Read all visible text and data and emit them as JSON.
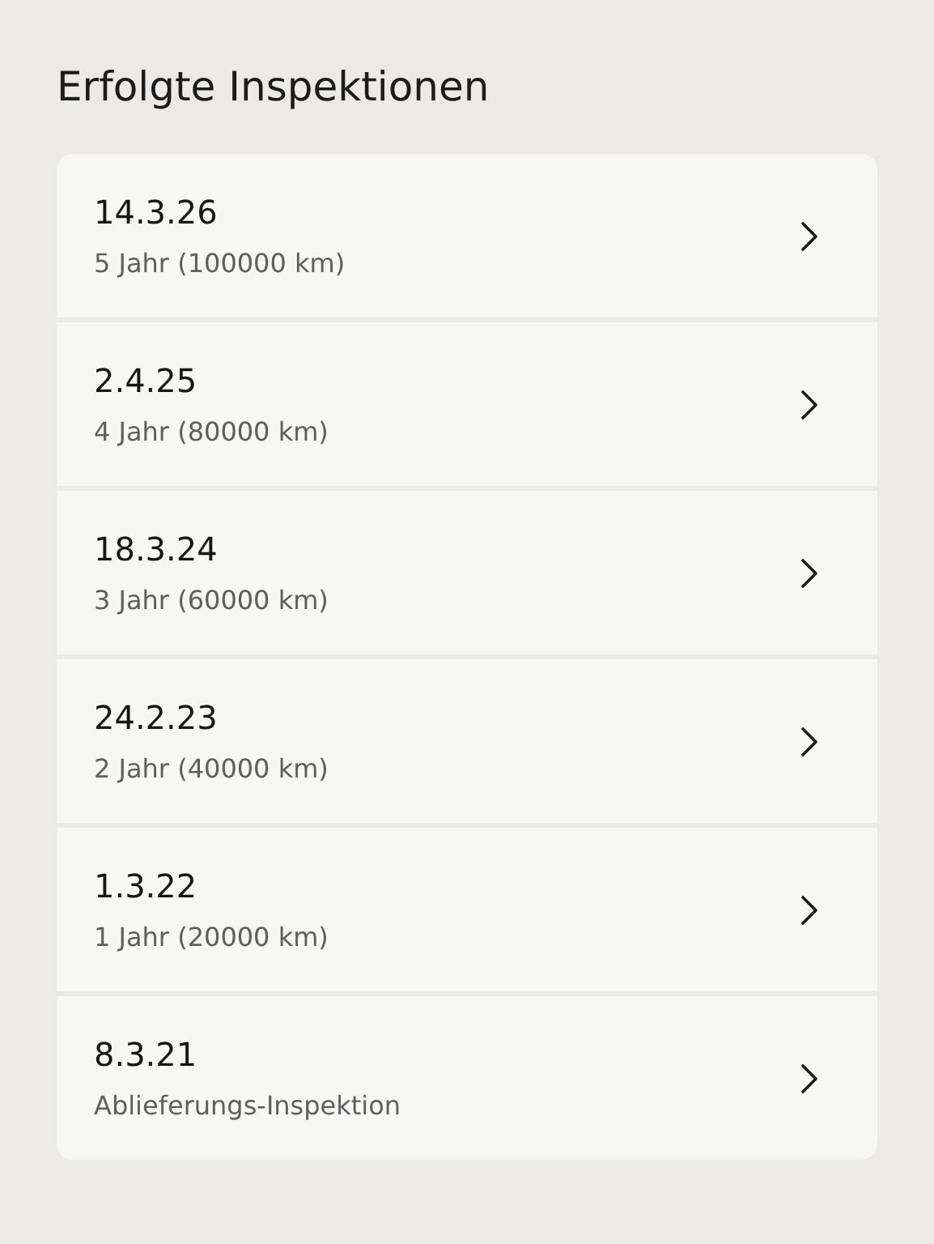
{
  "title": "Erfolgte Inspektionen",
  "inspections": [
    {
      "date": "14.3.26",
      "description": "5 Jahr (100000 km)"
    },
    {
      "date": "2.4.25",
      "description": "4 Jahr (80000 km)"
    },
    {
      "date": "18.3.24",
      "description": "3 Jahr (60000 km)"
    },
    {
      "date": "24.2.23",
      "description": "2 Jahr (40000 km)"
    },
    {
      "date": "1.3.22",
      "description": "1 Jahr (20000 km)"
    },
    {
      "date": "8.3.21",
      "description": "Ablieferungs-Inspektion"
    }
  ]
}
